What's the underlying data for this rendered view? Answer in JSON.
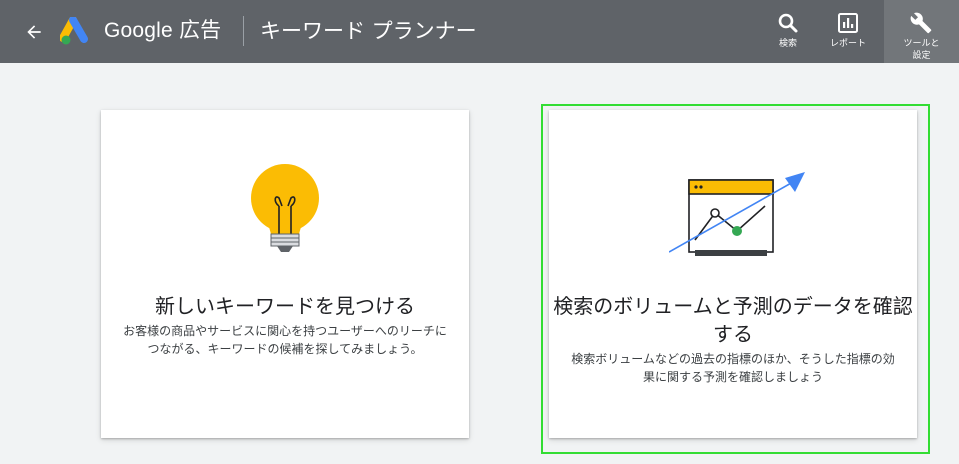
{
  "header": {
    "product_name": "Google 広告",
    "page_title": "キーワード プランナー",
    "tools": [
      {
        "label": "検索",
        "icon": "search-icon"
      },
      {
        "label": "レポート",
        "icon": "report-icon"
      },
      {
        "label": "ツールと\n設定",
        "icon": "wrench-icon"
      }
    ]
  },
  "cards": [
    {
      "title": "新しいキーワードを見つける",
      "description": "お客様の商品やサービスに関心を持つユーザーへのリーチにつながる、キーワードの候補を探してみましょう。",
      "icon": "lightbulb-icon"
    },
    {
      "title": "検索のボリュームと予測のデータを確認する",
      "description": "検索ボリュームなどの過去の指標のほか、そうした指標の効果に関する予測を確認しましょう",
      "icon": "forecast-chart-icon"
    }
  ],
  "colors": {
    "header_bg": "#5f6368",
    "highlight": "#33dd33",
    "bulb": "#fbbc04",
    "arrow": "#4285f4",
    "point": "#34a853"
  }
}
